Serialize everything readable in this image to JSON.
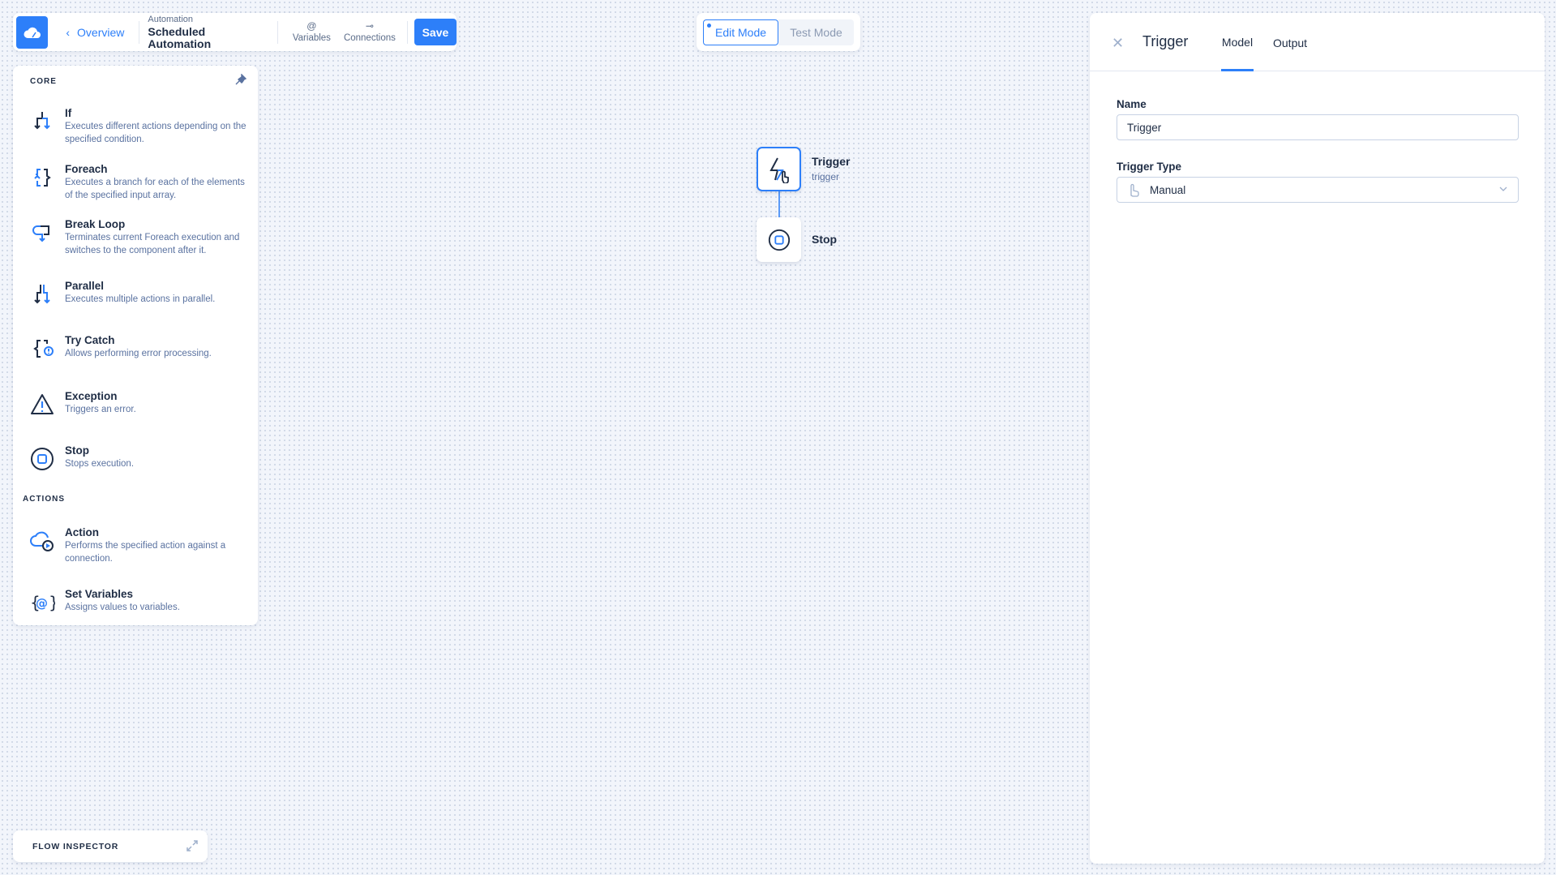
{
  "toolbar": {
    "back_label": "Overview",
    "crumb_section": "Automation",
    "crumb_title": "Scheduled Automation",
    "variables_label": "Variables",
    "connections_label": "Connections",
    "save_label": "Save",
    "accent": "#2d7ff9"
  },
  "modes": {
    "edit": "Edit Mode",
    "test": "Test Mode",
    "active": "Edit Mode"
  },
  "palette": {
    "core_heading": "CORE",
    "core": [
      {
        "title": "If",
        "desc": "Executes different actions depending on the specified condition.",
        "icon": "if-branch-icon"
      },
      {
        "title": "Foreach",
        "desc": "Executes a branch for each of the elements of the specified input array.",
        "icon": "foreach-icon"
      },
      {
        "title": "Break Loop",
        "desc": "Terminates current Foreach execution and switches to the component after it.",
        "icon": "break-loop-icon"
      },
      {
        "title": "Parallel",
        "desc": "Executes multiple actions in parallel.",
        "icon": "parallel-icon"
      },
      {
        "title": "Try Catch",
        "desc": "Allows performing error processing.",
        "icon": "try-catch-icon"
      },
      {
        "title": "Exception",
        "desc": "Triggers an error.",
        "icon": "warning-icon"
      },
      {
        "title": "Stop",
        "desc": "Stops execution.",
        "icon": "stop-icon"
      }
    ],
    "actions_heading": "ACTIONS",
    "actions": [
      {
        "title": "Action",
        "desc": "Performs the specified action against a connection.",
        "icon": "cloud-play-icon"
      },
      {
        "title": "Set Variables",
        "desc": "Assigns values to variables.",
        "icon": "variables-icon"
      }
    ]
  },
  "flow": {
    "trigger": {
      "label": "Trigger",
      "sub": "trigger"
    },
    "stop": {
      "label": "Stop"
    }
  },
  "panel": {
    "title": "Trigger",
    "tabs": [
      "Model",
      "Output"
    ],
    "active_tab": "Model",
    "name_label": "Name",
    "name_value": "Trigger",
    "type_label": "Trigger Type",
    "type_value": "Manual"
  },
  "flow_inspector": {
    "label": "FLOW INSPECTOR"
  }
}
